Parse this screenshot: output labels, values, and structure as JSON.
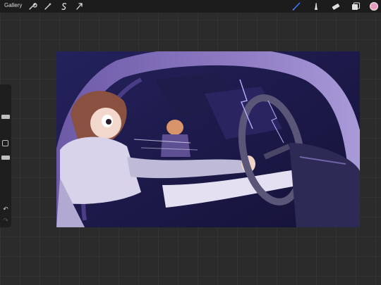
{
  "topbar": {
    "gallery_label": "Gallery",
    "left_tools": [
      {
        "icon": "wrench-icon"
      },
      {
        "icon": "magic-wand-icon"
      },
      {
        "icon": "selection-s-icon"
      },
      {
        "icon": "transform-arrow-icon"
      }
    ],
    "right_tools": [
      {
        "icon": "brush-icon",
        "active": true,
        "active_color": "#3d7bff"
      },
      {
        "icon": "smudge-icon"
      },
      {
        "icon": "eraser-icon"
      },
      {
        "icon": "layers-icon"
      }
    ],
    "current_color": "#e89ac0"
  },
  "sidebar": {
    "brush_size_slider": "size-slider",
    "opacity_slider": "opacity-slider",
    "undo_icon": "undo-icon",
    "redo_icon": "redo-icon"
  },
  "canvas": {
    "artwork": "car-interior-illustration"
  }
}
